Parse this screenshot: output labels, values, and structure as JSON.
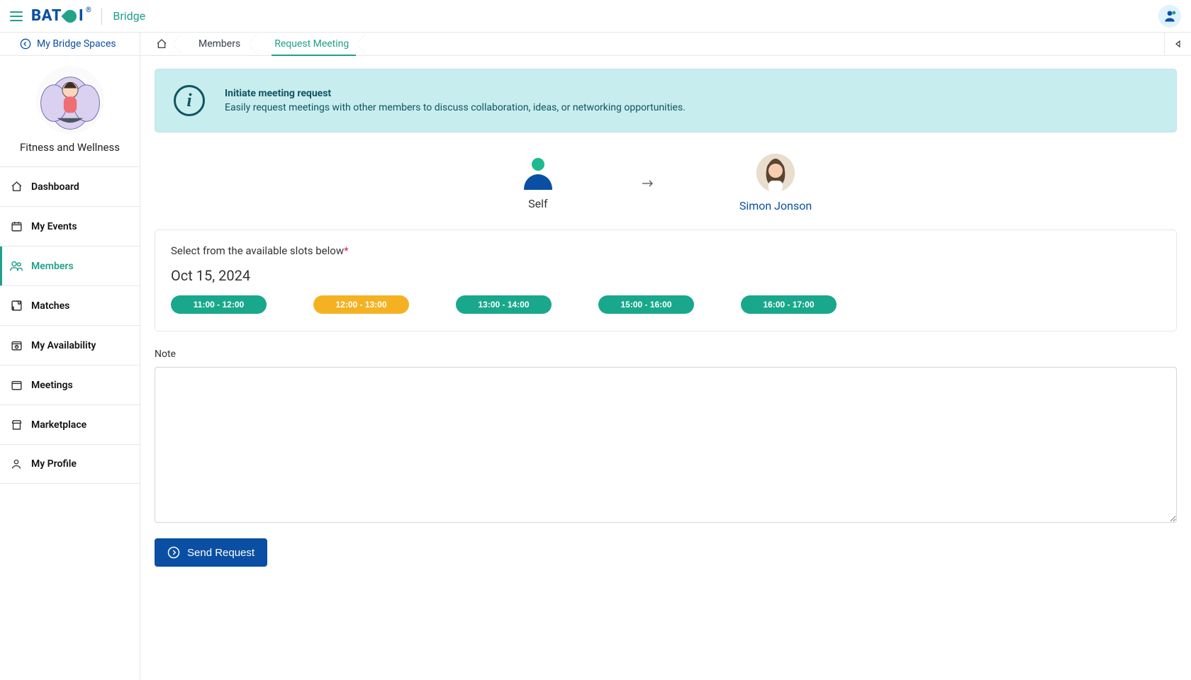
{
  "header": {
    "brand_letters_left": "BAT",
    "brand_letters_right": "I",
    "reg_mark": "®",
    "app_name": "Bridge"
  },
  "subheader": {
    "back_label": "My Bridge Spaces"
  },
  "breadcrumbs": {
    "items": [
      {
        "key": "members",
        "label": "Members"
      },
      {
        "key": "request-meeting",
        "label": "Request Meeting",
        "active": true
      }
    ]
  },
  "sidebar": {
    "space_name": "Fitness and Wellness",
    "items": [
      {
        "key": "dashboard",
        "label": "Dashboard",
        "icon": "home-icon"
      },
      {
        "key": "my-events",
        "label": "My Events",
        "icon": "calendar-icon"
      },
      {
        "key": "members",
        "label": "Members",
        "icon": "users-icon",
        "active": true
      },
      {
        "key": "matches",
        "label": "Matches",
        "icon": "puzzle-icon"
      },
      {
        "key": "availability",
        "label": "My Availability",
        "icon": "clock-icon"
      },
      {
        "key": "meetings",
        "label": "Meetings",
        "icon": "calendar2-icon"
      },
      {
        "key": "marketplace",
        "label": "Marketplace",
        "icon": "shop-icon"
      },
      {
        "key": "my-profile",
        "label": "My Profile",
        "icon": "person-icon"
      }
    ]
  },
  "banner": {
    "title": "Initiate meeting request",
    "description": "Easily request meetings with other members to discuss collaboration, ideas, or networking opportunities."
  },
  "participants": {
    "self_label": "Self",
    "recipient_name": "Simon Jonson"
  },
  "slots": {
    "title": "Select from the available slots below",
    "date": "Oct 15, 2024",
    "options": [
      {
        "label": "11:00 - 12:00",
        "selected": false
      },
      {
        "label": "12:00 - 13:00",
        "selected": true
      },
      {
        "label": "13:00 - 14:00",
        "selected": false
      },
      {
        "label": "15:00 - 16:00",
        "selected": false
      },
      {
        "label": "16:00 - 17:00",
        "selected": false
      }
    ]
  },
  "note": {
    "label": "Note",
    "value": ""
  },
  "actions": {
    "send_label": "Send Request"
  },
  "colors": {
    "teal": "#20a08a",
    "blue": "#0a4fa3",
    "amber": "#f4b223",
    "banner": "#c8edef"
  }
}
